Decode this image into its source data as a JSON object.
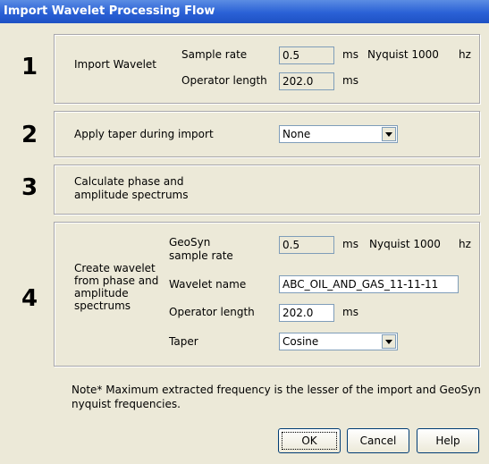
{
  "window": {
    "title": "Import Wavelet Processing Flow"
  },
  "steps": [
    "1",
    "2",
    "3",
    "4"
  ],
  "section1": {
    "label": "Import Wavelet",
    "sample_rate_label": "Sample rate",
    "sample_rate_value": "0.5",
    "sample_rate_unit": "ms",
    "nyquist_label": "Nyquist 1000",
    "nyquist_unit": "hz",
    "operator_length_label": "Operator length",
    "operator_length_value": "202.0",
    "operator_length_unit": "ms"
  },
  "section2": {
    "label": "Apply taper during import",
    "taper_value": "None"
  },
  "section3": {
    "label_line1": "Calculate phase and",
    "label_line2": "amplitude spectrums"
  },
  "section4": {
    "label_line1": "Create wavelet",
    "label_line2": "from phase and",
    "label_line3": "amplitude",
    "label_line4": "spectrums",
    "geosyn_label_line1": "GeoSyn",
    "geosyn_label_line2": "sample rate",
    "geosyn_value": "0.5",
    "geosyn_unit": "ms",
    "nyquist_label": "Nyquist 1000",
    "nyquist_unit": "hz",
    "wavelet_name_label": "Wavelet name",
    "wavelet_name_value": "ABC_OIL_AND_GAS_11-11-11",
    "operator_length_label": "Operator length",
    "operator_length_value": "202.0",
    "operator_length_unit": "ms",
    "taper_label": "Taper",
    "taper_value": "Cosine"
  },
  "note": {
    "line1": "Note* Maximum extracted frequency is the lesser of the import and GeoSyn",
    "line2": "nyquist frequencies."
  },
  "buttons": {
    "ok": "OK",
    "cancel": "Cancel",
    "help": "Help"
  }
}
